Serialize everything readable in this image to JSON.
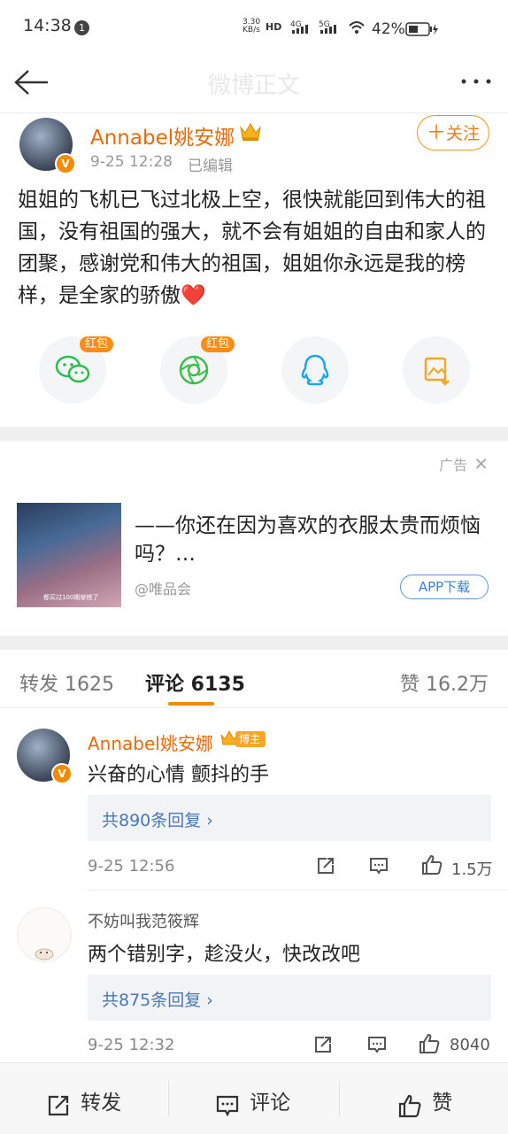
{
  "status_bar": {
    "time": "14:38",
    "notif_count": "1",
    "net_speed": "3.30\nKB/s",
    "battery": "42%"
  },
  "nav": {
    "title": "微博正文"
  },
  "post": {
    "username": "Annabel姚安娜",
    "time": "9-25 12:28",
    "edited": "已编辑",
    "follow_label": "关注",
    "text": "姐姐的飞机已飞过北极上空，很快就能回到伟大的祖国，没有祖国的强大，就不会有姐姐的自由和家人的团聚，感谢党和伟大的祖国，姐姐你永远是我的榜样，是全家的骄傲❤️",
    "share_badge": "红包"
  },
  "ad": {
    "label": "广告",
    "text": "——你还在因为喜欢的衣服太贵而烦恼吗？…",
    "source": "@唯品会",
    "button": "APP下载",
    "image_caption": "都买过100期穿搭了"
  },
  "tabs": {
    "repost": "转发 1625",
    "comment": "评论 6135",
    "like": "赞 16.2万"
  },
  "comments": [
    {
      "name": "Annabel姚安娜",
      "badge": "博主",
      "text": "兴奋的心情 颤抖的手",
      "replies": "共890条回复 ›",
      "time": "9-25 12:56",
      "likes": "1.5万"
    },
    {
      "name": "不妨叫我范筱辉",
      "text": "两个错别字，趁没火，快改改吧",
      "replies": "共875条回复 ›",
      "time": "9-25 12:32",
      "likes": "8040"
    }
  ],
  "bottom": {
    "repost": "转发",
    "comment": "评论",
    "like": "赞"
  },
  "colors": {
    "accent": "#f28a00",
    "name": "#e86b0b",
    "link": "#4a77b7"
  }
}
